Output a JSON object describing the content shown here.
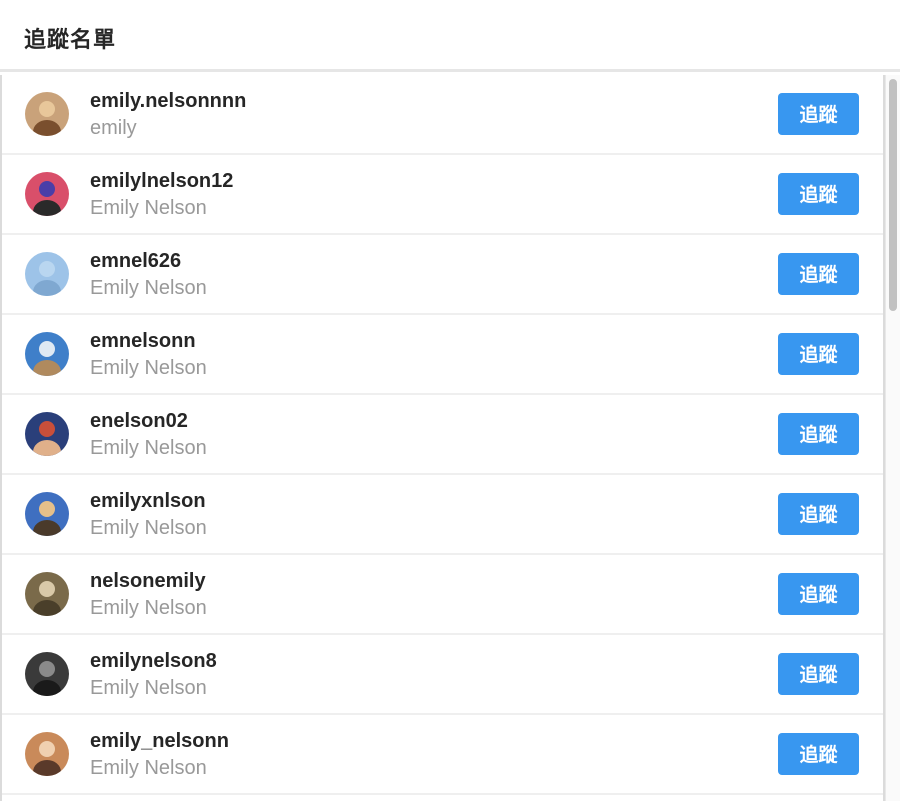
{
  "header": {
    "title": "追蹤名單"
  },
  "users": [
    {
      "username": "emily.nelsonnnn",
      "fullname": "emily",
      "button": "追蹤",
      "avatar_colors": [
        "#c9a27a",
        "#e8c79a",
        "#7a4f2e"
      ]
    },
    {
      "username": "emilylnelson12",
      "fullname": "Emily Nelson",
      "button": "追蹤",
      "avatar_colors": [
        "#d94f6a",
        "#4a3ea8",
        "#2a2a2a"
      ]
    },
    {
      "username": "emnel626",
      "fullname": "Emily Nelson",
      "button": "追蹤",
      "avatar_colors": [
        "#9dc3e8",
        "#b9d6f0",
        "#7fa8d1"
      ]
    },
    {
      "username": "emnelsonn",
      "fullname": "Emily Nelson",
      "button": "追蹤",
      "avatar_colors": [
        "#3f7fc9",
        "#dfe9f3",
        "#b08a5e"
      ]
    },
    {
      "username": "enelson02",
      "fullname": "Emily Nelson",
      "button": "追蹤",
      "avatar_colors": [
        "#2a3f7a",
        "#c94f3a",
        "#e0b08a"
      ]
    },
    {
      "username": "emilyxnlson",
      "fullname": "Emily Nelson",
      "button": "追蹤",
      "avatar_colors": [
        "#3f6fc0",
        "#e6c08a",
        "#4a3a2a"
      ]
    },
    {
      "username": "nelsonemily",
      "fullname": "Emily Nelson",
      "button": "追蹤",
      "avatar_colors": [
        "#7a6a4a",
        "#d9c9a8",
        "#4a3f2a"
      ]
    },
    {
      "username": "emilynelson8",
      "fullname": "Emily Nelson",
      "button": "追蹤",
      "avatar_colors": [
        "#3a3a3a",
        "#8a8a8a",
        "#1a1a1a"
      ]
    },
    {
      "username": "emily_nelsonn",
      "fullname": "Emily Nelson",
      "button": "追蹤",
      "avatar_colors": [
        "#c98a5a",
        "#f0d0b0",
        "#5a3a2a"
      ]
    }
  ]
}
